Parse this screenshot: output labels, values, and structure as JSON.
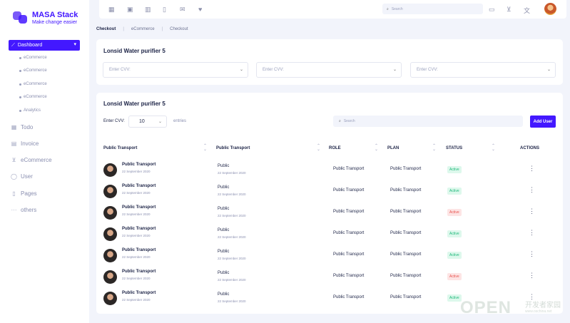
{
  "brand": {
    "name": "MASA Stack",
    "tagline": "Make change easier"
  },
  "sidebar": {
    "active_item": "Dashboard",
    "sub_items": [
      "eCommerce",
      "eCommerce",
      "eCommerce",
      "eCommerce",
      "Analytics"
    ],
    "items": [
      {
        "label": "Todo",
        "icon": "calendar-check-icon"
      },
      {
        "label": "Invoice",
        "icon": "document-icon"
      },
      {
        "label": "eCommerce",
        "icon": "cart-icon"
      },
      {
        "label": "User",
        "icon": "user-icon"
      },
      {
        "label": "Pages",
        "icon": "page-icon"
      },
      {
        "label": "others",
        "icon": "more-icon"
      }
    ]
  },
  "topbar": {
    "search_placeholder": "Search",
    "icons": [
      "table-icon",
      "browser-icon",
      "calendar-icon",
      "clipboard-icon",
      "mail-icon",
      "heart-icon",
      "chat-icon",
      "cart-icon",
      "translate-icon"
    ]
  },
  "breadcrumb": {
    "current": "Checkout",
    "items": [
      "eCommerce",
      "Checkout"
    ]
  },
  "filters": {
    "title": "Lonsid Water purifier 5",
    "selects": [
      "Enter CVV:",
      "Enter CVV:",
      "Enter CVV:"
    ]
  },
  "table_card": {
    "title": "Lonsid Water purifier 5",
    "length_label": "Enter CVV:",
    "length_value": "10",
    "entries_label": "entries",
    "search_placeholder": "Search",
    "add_button": "Add User",
    "headers": [
      "Public Transport",
      "Public Transport",
      "ROLE",
      "PLAN",
      "STATUS",
      "ACTIONS"
    ],
    "rows": [
      {
        "name": "Public Transport",
        "date": "22 September 2020",
        "plain": "Public",
        "plain_date": "22 September 2020",
        "role": "Public Transport",
        "plan": "Public Transport",
        "status": "Active",
        "status_type": "green"
      },
      {
        "name": "Public Transport",
        "date": "22 September 2020",
        "plain": "Public",
        "plain_date": "22 September 2020",
        "role": "Public Transport",
        "plan": "Public Transport",
        "status": "Active",
        "status_type": "green"
      },
      {
        "name": "Public Transport",
        "date": "22 September 2020",
        "plain": "Public",
        "plain_date": "22 September 2020",
        "role": "Public Transport",
        "plan": "Public Transport",
        "status": "Active",
        "status_type": "red"
      },
      {
        "name": "Public Transport",
        "date": "22 September 2020",
        "plain": "Public",
        "plain_date": "22 September 2020",
        "role": "Public Transport",
        "plan": "Public Transport",
        "status": "Active",
        "status_type": "green"
      },
      {
        "name": "Public Transport",
        "date": "22 September 2020",
        "plain": "Public",
        "plain_date": "22 September 2020",
        "role": "Public Transport",
        "plan": "Public Transport",
        "status": "Active",
        "status_type": "green"
      },
      {
        "name": "Public Transport",
        "date": "22 September 2020",
        "plain": "Public",
        "plain_date": "22 September 2020",
        "role": "Public Transport",
        "plan": "Public Transport",
        "status": "Active",
        "status_type": "red"
      },
      {
        "name": "Public Transport",
        "date": "22 September 2020",
        "plain": "Public",
        "plain_date": "22 September 2020",
        "role": "Public Transport",
        "plan": "Public Transport",
        "status": "Active",
        "status_type": "green"
      }
    ]
  },
  "watermark": {
    "text": "OPEN",
    "cn": "开发者家园",
    "url": "www.oschina.net"
  },
  "colors": {
    "accent": "#4318ff",
    "active_green": "#1eb87a",
    "inactive_red": "#e8534f",
    "background": "#f2f4fb"
  }
}
